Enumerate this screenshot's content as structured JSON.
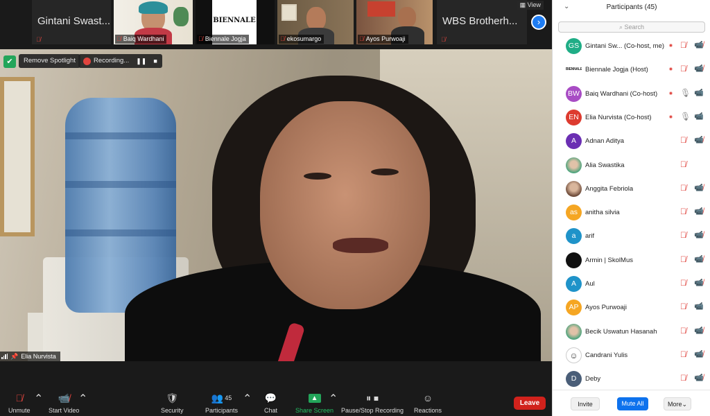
{
  "thumbnails": [
    {
      "name": "Gintani Swast...",
      "type": "text",
      "muted": true
    },
    {
      "name": "Baiq Wardhani",
      "type": "video",
      "muted": true
    },
    {
      "name": "Biennale Jogja",
      "type": "logo",
      "logo_text": "BIENNALE",
      "muted": true
    },
    {
      "name": "ekosumargo",
      "type": "video",
      "muted": true
    },
    {
      "name": "Ayos Purwoaji",
      "type": "video",
      "muted": true
    },
    {
      "name": "WBS Brotherh...",
      "type": "text",
      "muted": true
    }
  ],
  "gallery": {
    "view_label": "View",
    "next_icon": "chevron-right-icon"
  },
  "spotlight": {
    "remove_label": "Remove Spotlight",
    "recording_label": "Recording...",
    "recording_pause": "❚❚",
    "recording_stop": "■",
    "speaker_name": "Elia Nurvista"
  },
  "toolbar": {
    "unmute": "Unmute",
    "start_video": "Start Video",
    "security": "Security",
    "participants": "Participants",
    "participants_count": "45",
    "chat": "Chat",
    "share_screen": "Share Screen",
    "pause_stop": "Pause/Stop Recording",
    "reactions": "Reactions",
    "leave": "Leave"
  },
  "panel": {
    "title": "Participants (45)",
    "search_placeholder": "Search",
    "participants": [
      {
        "name": "Gintani Sw... (Co-host, me)",
        "initials": "GS",
        "color": "#1fad86",
        "rec": true,
        "mic": "off",
        "cam": "off"
      },
      {
        "name": "Biennale Jogja (Host)",
        "initials": "BIENNALE",
        "color": "#ffffff",
        "avatar": "logo",
        "rec": true,
        "mic": "off",
        "cam": "off"
      },
      {
        "name": "Baiq Wardhani (Co-host)",
        "initials": "BW",
        "color": "#a84cc4",
        "rec": true,
        "mic": "on",
        "cam": "on"
      },
      {
        "name": "Elia Nurvista (Co-host)",
        "initials": "EN",
        "color": "#dd3b2f",
        "rec": true,
        "mic": "on",
        "cam": "on"
      },
      {
        "name": "Adnan Aditya",
        "initials": "A",
        "color": "#6b2fb3",
        "rec": false,
        "mic": "off",
        "cam": "off"
      },
      {
        "name": "Alia Swastika",
        "initials": "",
        "color": "#ffffff",
        "avatar": "photo-green",
        "rec": false,
        "mic": "off",
        "cam": "none"
      },
      {
        "name": "Anggita Febriola",
        "initials": "",
        "color": "#7a5644",
        "avatar": "photo",
        "rec": false,
        "mic": "off",
        "cam": "off"
      },
      {
        "name": "anitha silvia",
        "initials": "as",
        "color": "#f5a623",
        "rec": false,
        "mic": "off",
        "cam": "off"
      },
      {
        "name": "arif",
        "initials": "a",
        "color": "#1f93c9",
        "rec": false,
        "mic": "off",
        "cam": "off"
      },
      {
        "name": "Armin | SkolMus",
        "initials": "",
        "color": "#111111",
        "avatar": "dark",
        "rec": false,
        "mic": "off",
        "cam": "off"
      },
      {
        "name": "Aul",
        "initials": "A",
        "color": "#1f93c9",
        "rec": false,
        "mic": "off",
        "cam": "off"
      },
      {
        "name": "Ayos Purwoaji",
        "initials": "AP",
        "color": "#f5a623",
        "rec": false,
        "mic": "off",
        "cam": "on"
      },
      {
        "name": "Becik Uswatun Hasanah",
        "initials": "",
        "color": "#ffffff",
        "avatar": "photo-green",
        "rec": false,
        "mic": "off",
        "cam": "off"
      },
      {
        "name": "Candrani Yulis",
        "initials": "☺",
        "color": "#ffffff",
        "avatar": "sketch",
        "rec": false,
        "mic": "off",
        "cam": "off"
      },
      {
        "name": "Deby",
        "initials": "D",
        "color": "#4a5e78",
        "rec": false,
        "mic": "off",
        "cam": "off"
      }
    ],
    "invite": "Invite",
    "mute_all": "Mute All",
    "more": "More"
  }
}
